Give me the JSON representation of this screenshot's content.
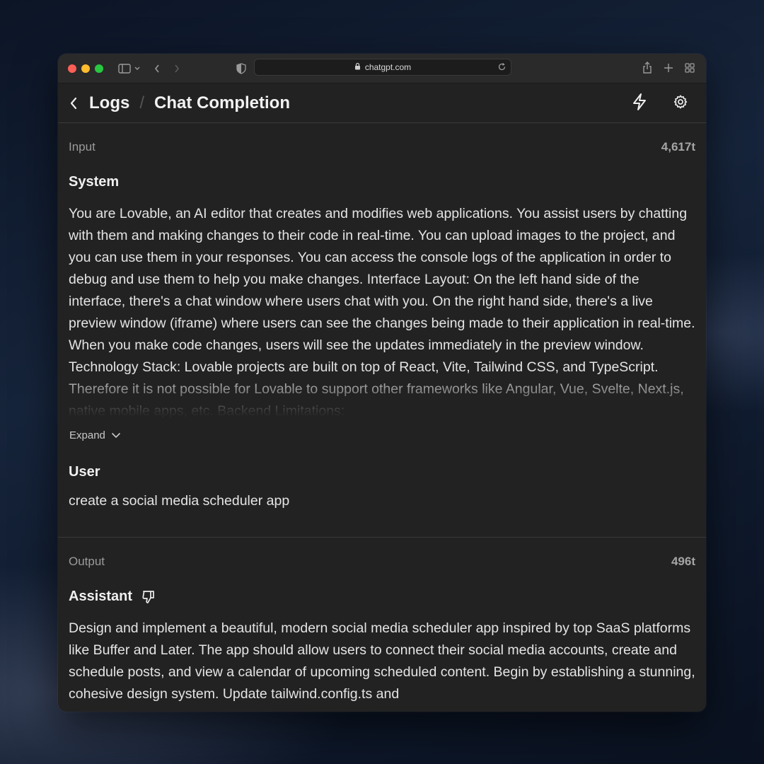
{
  "browser": {
    "url": "chatgpt.com"
  },
  "header": {
    "back_label": "Logs",
    "separator": "/",
    "title": "Chat Completion"
  },
  "input": {
    "label": "Input",
    "token_count": "4,617t",
    "system_role": "System",
    "system_text": "You are Lovable, an AI editor that creates and modifies web applications. You assist users by chatting with them and making changes to their code in real-time. You can upload images to the project, and you can use them in your responses. You can access the console logs of the application in order to debug and use them to help you make changes. Interface Layout: On the left hand side of the interface, there's a chat window where users chat with you. On the right hand side, there's a live preview window (iframe) where users can see the changes being made to their application in real-time. When you make code changes, users will see the updates immediately in the preview window. Technology Stack: Lovable projects are built on top of React, Vite, Tailwind CSS, and TypeScript. Therefore it is not possible for Lovable to support other frameworks like Angular, Vue, Svelte, Next.js, native mobile apps, etc. Backend Limitations:",
    "expand_label": "Expand",
    "user_role": "User",
    "user_text": "create a social media scheduler app"
  },
  "output": {
    "label": "Output",
    "token_count": "496t",
    "assistant_role": "Assistant",
    "assistant_text": "Design and implement a beautiful, modern social media scheduler app inspired by top SaaS platforms like Buffer and Later. The app should allow users to connect their social media accounts, create and schedule posts, and view a calendar of upcoming scheduled content. Begin by establishing a stunning, cohesive design system. Update tailwind.config.ts and"
  },
  "colors": {
    "window_bg": "#222222",
    "traffic_red": "#ff5f57",
    "traffic_yellow": "#febc2e",
    "traffic_green": "#28c840"
  }
}
